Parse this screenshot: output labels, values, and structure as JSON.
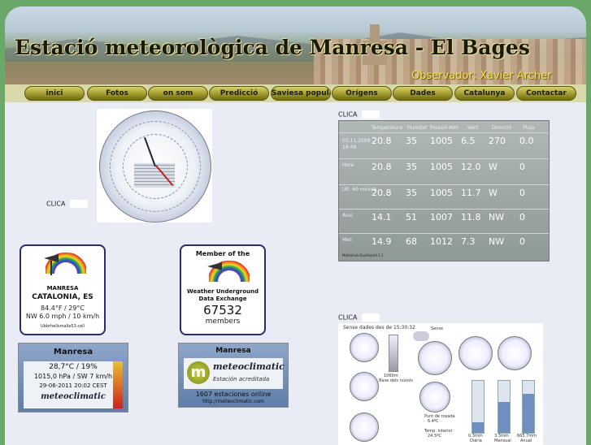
{
  "header": {
    "title": "Estació meteorològica de Manresa - El Bages",
    "observer": "Observador: Xavier Archer"
  },
  "nav": {
    "items": [
      "inici",
      "Fotos",
      "on som",
      "Predicció",
      "Saviesa popular",
      "Orígens",
      "Dades",
      "Catalunya",
      "Contactar"
    ]
  },
  "clica": [
    "CLICA",
    "CLICA",
    "CLICA"
  ],
  "dashboard": {
    "headers": [
      "Temperatura",
      "Humitat",
      "Pressió Atm",
      "Vent",
      "Direcció",
      "Pluja"
    ],
    "date": "03.11.2009",
    "time": "18:48",
    "rows": [
      {
        "label": "",
        "temp": "20.8",
        "hum": "35",
        "pres": "1005",
        "wind": "6.5",
        "dir": "270",
        "rain": "0.0"
      },
      {
        "label": "Hora",
        "temp": "20.8",
        "hum": "35",
        "pres": "1005",
        "wind": "12.0",
        "dir": "W",
        "rain": "0"
      },
      {
        "label": "Ult. 60 minuts",
        "temp": "20.8",
        "hum": "35",
        "pres": "1005",
        "wind": "11.7",
        "dir": "W",
        "rain": "0"
      },
      {
        "label": "Avui",
        "temp": "14.1",
        "hum": "51",
        "pres": "1007",
        "wind": "11.8",
        "dir": "NW",
        "rain": "0"
      },
      {
        "label": "Mes",
        "temp": "14.9",
        "hum": "68",
        "pres": "1012",
        "wind": "7.3",
        "dir": "NW",
        "rain": "0"
      }
    ],
    "footer": "Meteohub Dashboard 1.1"
  },
  "wunder_station": {
    "name": "MANRESA",
    "region": "CATALONIA, ES",
    "temp": "84.4°F / 29°C",
    "wind": "NW 6.0 mph / 10 km/h",
    "site": "Ubbrhellsmalle53.cell"
  },
  "wunder_member": {
    "line1": "Member of the",
    "line2": "Weather Underground",
    "line3": "Data Exchange",
    "count": "67532",
    "line4": "members"
  },
  "meteoclimatic_station": {
    "name": "Manresa",
    "temp_hum": "28,7°C / 19%",
    "pressure_wind": "1015,0 hPa / SW 7 km/h",
    "datetime": "29-06-2011 20:02 CEST",
    "brand": "meteoclimatic"
  },
  "meteoclimatic_network": {
    "name": "Manresa",
    "brand": "meteoclimatic",
    "subtitle": "Estación acreditada",
    "stations": "1607 estaciones online",
    "url": "http://meteoclimatic.com"
  },
  "gauges_panel": {
    "title": "Sense dades des de 15:30:32",
    "labels": [
      "Sense",
      "Base dels núvols",
      "Punt de rosada",
      "Temp. interior",
      "Diària",
      "Mensual",
      "Anual"
    ],
    "values": [
      "1060m",
      "6.4ºC",
      "24.5ºC",
      "0.3mm",
      "3.3mm",
      "665.7mm"
    ]
  },
  "colors": {
    "background": "#6aa86a",
    "title_yellow": "#f4e14a",
    "nav_gold": "#9a9428"
  }
}
